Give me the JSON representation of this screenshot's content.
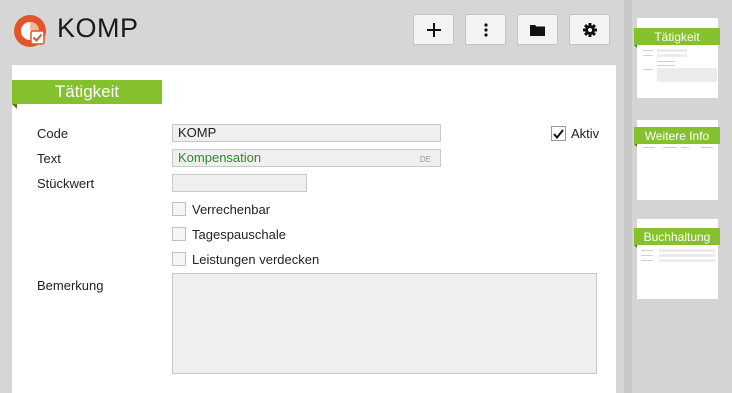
{
  "header": {
    "title": "KOMP",
    "logo_icon": "app-logo-icon",
    "buttons": [
      {
        "name": "add-button",
        "icon": "plus-icon"
      },
      {
        "name": "more-button",
        "icon": "kebab-menu-icon"
      },
      {
        "name": "folder-button",
        "icon": "folder-icon"
      },
      {
        "name": "settings-button",
        "icon": "gear-icon"
      }
    ]
  },
  "section": {
    "title": "Tätigkeit"
  },
  "form": {
    "code_label": "Code",
    "code_value": "KOMP",
    "text_label": "Text",
    "text_value": "Kompensation",
    "text_lang": "DE",
    "stueckwert_label": "Stückwert",
    "stueckwert_value": "",
    "aktiv_label": "Aktiv",
    "aktiv_checked": true,
    "checkboxes": [
      {
        "label": "Verrechenbar",
        "checked": false
      },
      {
        "label": "Tagespauschale",
        "checked": false
      },
      {
        "label": "Leistungen verdecken",
        "checked": false
      }
    ],
    "bemerkung_label": "Bemerkung",
    "bemerkung_value": ""
  },
  "sidebar": {
    "pages": [
      {
        "label": "Tätigkeit"
      },
      {
        "label": "Weitere Info"
      },
      {
        "label": "Buchhaltung"
      }
    ]
  },
  "colors": {
    "accent": "#84c12c",
    "logo": "#e2552b"
  }
}
